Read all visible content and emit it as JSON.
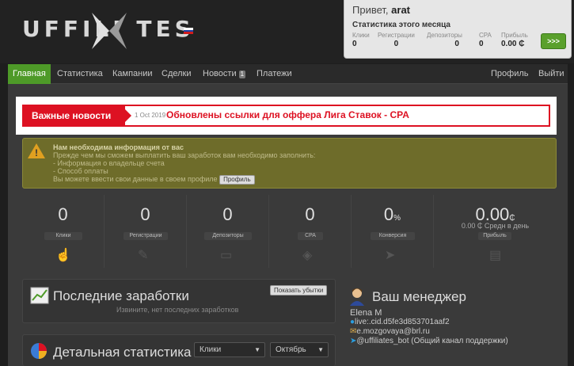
{
  "header": {
    "logo_text": "UFFILI TES",
    "greeting": "Привет,",
    "user": "arat",
    "month_stats_title": "Статистика этого месяца",
    "stats": [
      {
        "label": "Клики",
        "value": "0"
      },
      {
        "label": "Регистрации",
        "value": "0"
      },
      {
        "label": "Депозиторы",
        "value": "0"
      },
      {
        "label": "CPA",
        "value": "0"
      },
      {
        "label": "Прибыль",
        "value": "0.00 ₵"
      }
    ],
    "go_label": ">>>"
  },
  "nav": {
    "items": [
      "Главная",
      "Статистика",
      "Кампании",
      "Сделки",
      "Новости",
      "Платежи"
    ],
    "news_badge": "1",
    "profile": "Профиль",
    "logout": "Выйти"
  },
  "news": {
    "tag": "Важные новости",
    "date": "1 Oct 2019",
    "headline": "Обновлены ссылки для оффера Лига Ставок - CPA"
  },
  "alert": {
    "title": "Нам необходима информация от вас",
    "lines": [
      "Прежде чем мы сможем выплатить ваш заработок вам необходимо заполнить:",
      "- Информация о владельце счета",
      "- Способ оплаты"
    ],
    "cta_text": "Вы можете ввести свои данные в своем профиле",
    "cta_button": "Профиль"
  },
  "stats": [
    {
      "value": "0",
      "label": "Клики",
      "icon": "hand-pointer-icon"
    },
    {
      "value": "0",
      "label": "Регистрации",
      "icon": "form-icon"
    },
    {
      "value": "0",
      "label": "Депозиторы",
      "icon": "money-icon"
    },
    {
      "value": "0",
      "label": "CPA",
      "icon": "eye-icon"
    },
    {
      "value": "0",
      "unit": "%",
      "label": "Конверсия",
      "icon": "arrow-right-icon"
    },
    {
      "value": "0.00",
      "unit": "₵",
      "sub": "0.00 ₵ Средн в день",
      "label": "Прибыль",
      "icon": "cash-stack-icon"
    }
  ],
  "earnings": {
    "title": "Последние заработки",
    "show_losses": "Показать убытки",
    "empty": "Извините, нет последних заработков"
  },
  "detail": {
    "title": "Детальная статистика",
    "metric": "Клики",
    "month": "Октябрь"
  },
  "manager": {
    "title": "Ваш менеджер",
    "name": "Elena M",
    "skype": "live:.cid.d5fe3d853701aaf2",
    "email": "e.mozgovaya@brl.ru",
    "telegram": "@uffiliates_bot (Общий канал поддержки)"
  },
  "colors": {
    "accent": "#4e9a28",
    "news_red": "#dd1122",
    "alert_bg": "#6e6c2a"
  }
}
